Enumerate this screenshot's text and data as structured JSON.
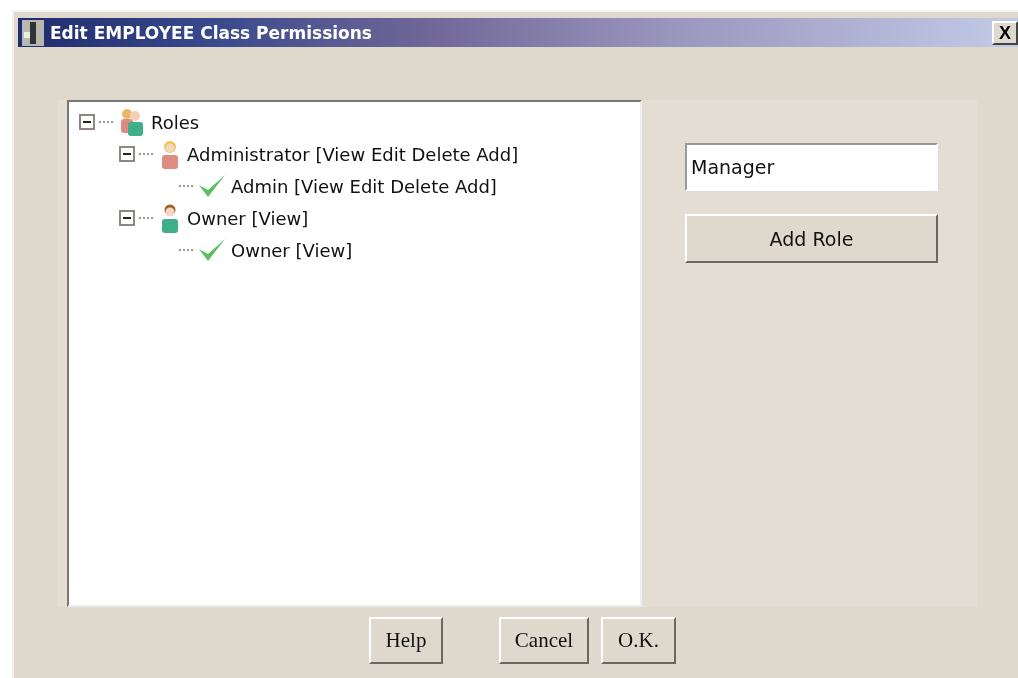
{
  "window": {
    "title": "Edit EMPLOYEE Class Permissions",
    "close": "X"
  },
  "tree": [
    {
      "kind": "group",
      "label": "Roles",
      "expanded": true,
      "children": [
        {
          "kind": "role-female",
          "label": "Administrator [View Edit Delete Add]",
          "expanded": true,
          "children": [
            {
              "kind": "permission",
              "label": "Admin [View Edit Delete Add]"
            }
          ]
        },
        {
          "kind": "role-male",
          "label": "Owner [View]",
          "expanded": true,
          "children": [
            {
              "kind": "permission",
              "label": "Owner [View]"
            }
          ]
        }
      ]
    }
  ],
  "role_field": {
    "value": "Manager"
  },
  "add_button": "Add Role",
  "buttons": [
    "Help",
    "Cancel",
    "O.K."
  ]
}
